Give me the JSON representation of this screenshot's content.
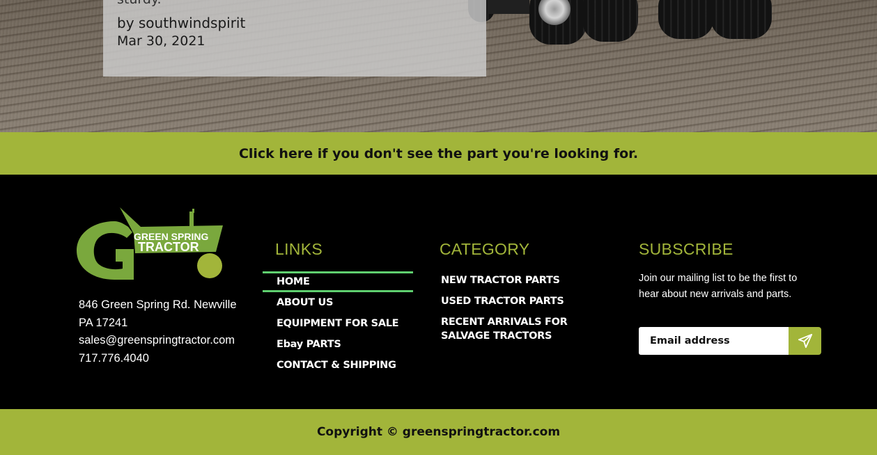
{
  "hero": {
    "cut_text": "sturdy.",
    "author": "by southwindspirit",
    "date": "Mar 30, 2021"
  },
  "band": {
    "text": "Click here if you don't see the part you're looking for."
  },
  "footer": {
    "logo": {
      "line1": "GREEN SPRING",
      "line2": "TRACTOR",
      "icon": "tractor-logo-icon"
    },
    "address": {
      "line1": "846 Green Spring Rd. Newville",
      "line2": "PA 17241",
      "email": "sales@greenspringtractor.com",
      "phone": "717.776.4040"
    },
    "links": {
      "title": "LINKS",
      "items": [
        {
          "label": "HOME"
        },
        {
          "label": "ABOUT US"
        },
        {
          "label": "EQUIPMENT FOR SALE"
        },
        {
          "label": "Ebay PARTS"
        },
        {
          "label": "CONTACT & SHIPPING"
        }
      ]
    },
    "category": {
      "title": "CATEGORY",
      "items": [
        {
          "label": "NEW TRACTOR PARTS"
        },
        {
          "label": "USED TRACTOR PARTS"
        },
        {
          "label": "RECENT ARRIVALS FOR SALVAGE TRACTORS"
        }
      ]
    },
    "subscribe": {
      "title": "SUBSCRIBE",
      "text": "Join our mailing list to be the first to hear about new arrivals and parts.",
      "placeholder": "Email address",
      "button_icon": "send-icon"
    }
  },
  "copyright": "Copyright © greenspringtractor.com",
  "colors": {
    "accent_green": "#a2b53a",
    "active_underline": "#5fcf6f",
    "footer_bg": "#000000"
  }
}
